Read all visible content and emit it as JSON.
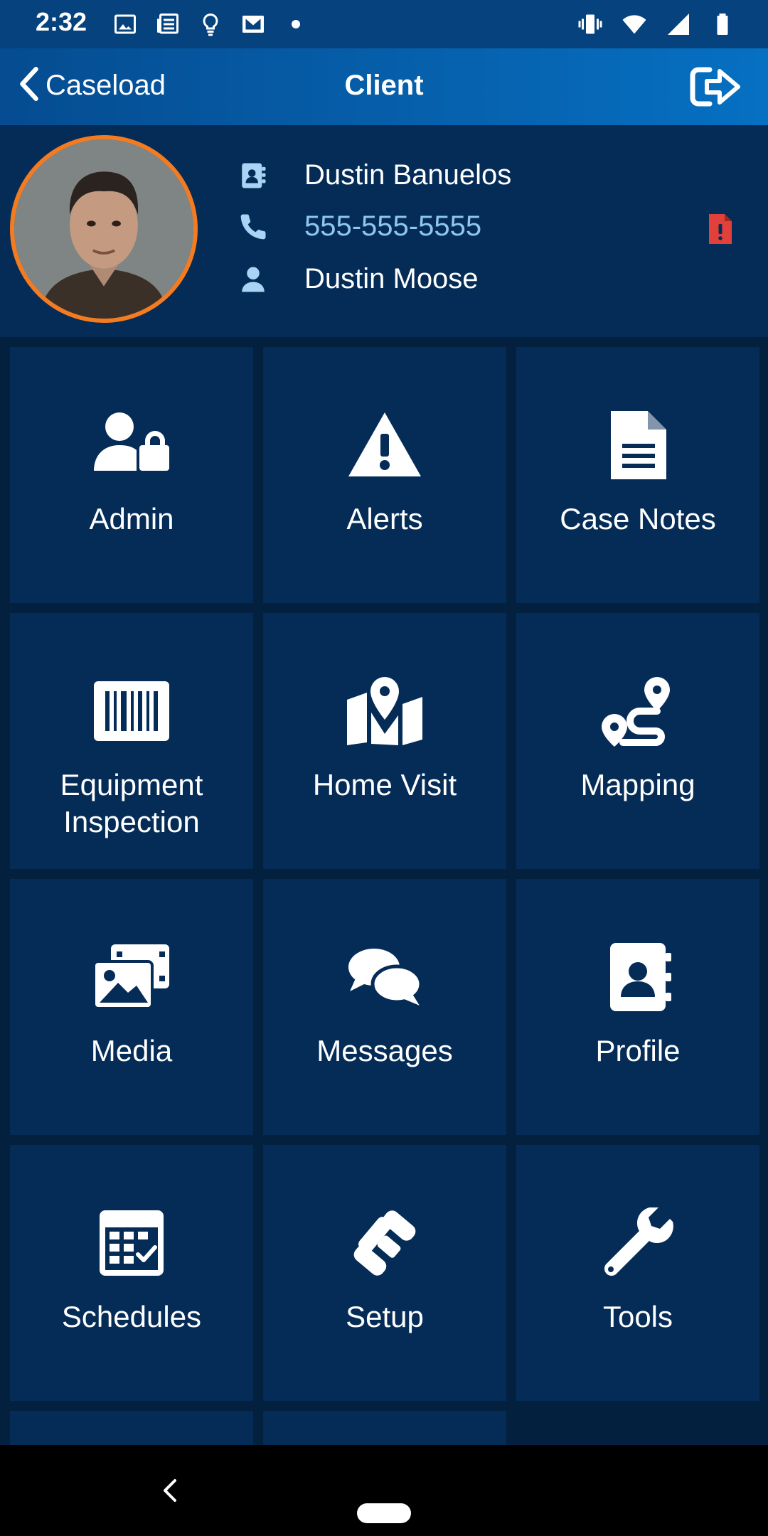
{
  "status_bar": {
    "time": "2:32",
    "left_icons": [
      "image-icon",
      "news-icon",
      "lightbulb-icon",
      "mail-icon",
      "dot-icon"
    ],
    "right_icons": [
      "vibrate-icon",
      "wifi-icon",
      "signal-icon",
      "battery-icon"
    ]
  },
  "app_bar": {
    "back_label": "Caseload",
    "title": "Client",
    "logout_icon": "logout-icon"
  },
  "client": {
    "name": "Dustin  Banuelos",
    "phone": "555-555-5555",
    "officer": "Dustin Moose",
    "accent_color": "#f47b20",
    "alert_color": "#e2403a"
  },
  "tiles": [
    {
      "label": "Admin",
      "icon": "user-lock-icon"
    },
    {
      "label": "Alerts",
      "icon": "warning-icon"
    },
    {
      "label": "Case Notes",
      "icon": "document-icon"
    },
    {
      "label": "Equipment\nInspection",
      "icon": "barcode-icon"
    },
    {
      "label": "Home Visit",
      "icon": "map-marker-icon"
    },
    {
      "label": "Mapping",
      "icon": "route-icon"
    },
    {
      "label": "Media",
      "icon": "images-icon"
    },
    {
      "label": "Messages",
      "icon": "chat-icon"
    },
    {
      "label": "Profile",
      "icon": "contact-card-icon"
    },
    {
      "label": "Schedules",
      "icon": "calendar-check-icon"
    },
    {
      "label": "Setup",
      "icon": "phone-setup-icon"
    },
    {
      "label": "Tools",
      "icon": "wrench-icon"
    }
  ],
  "colors": {
    "background": "#03213f",
    "tile": "#052c57",
    "appbar_start": "#054c91",
    "appbar_end": "#0670c2",
    "icon_light_blue": "#a9d4f5"
  }
}
